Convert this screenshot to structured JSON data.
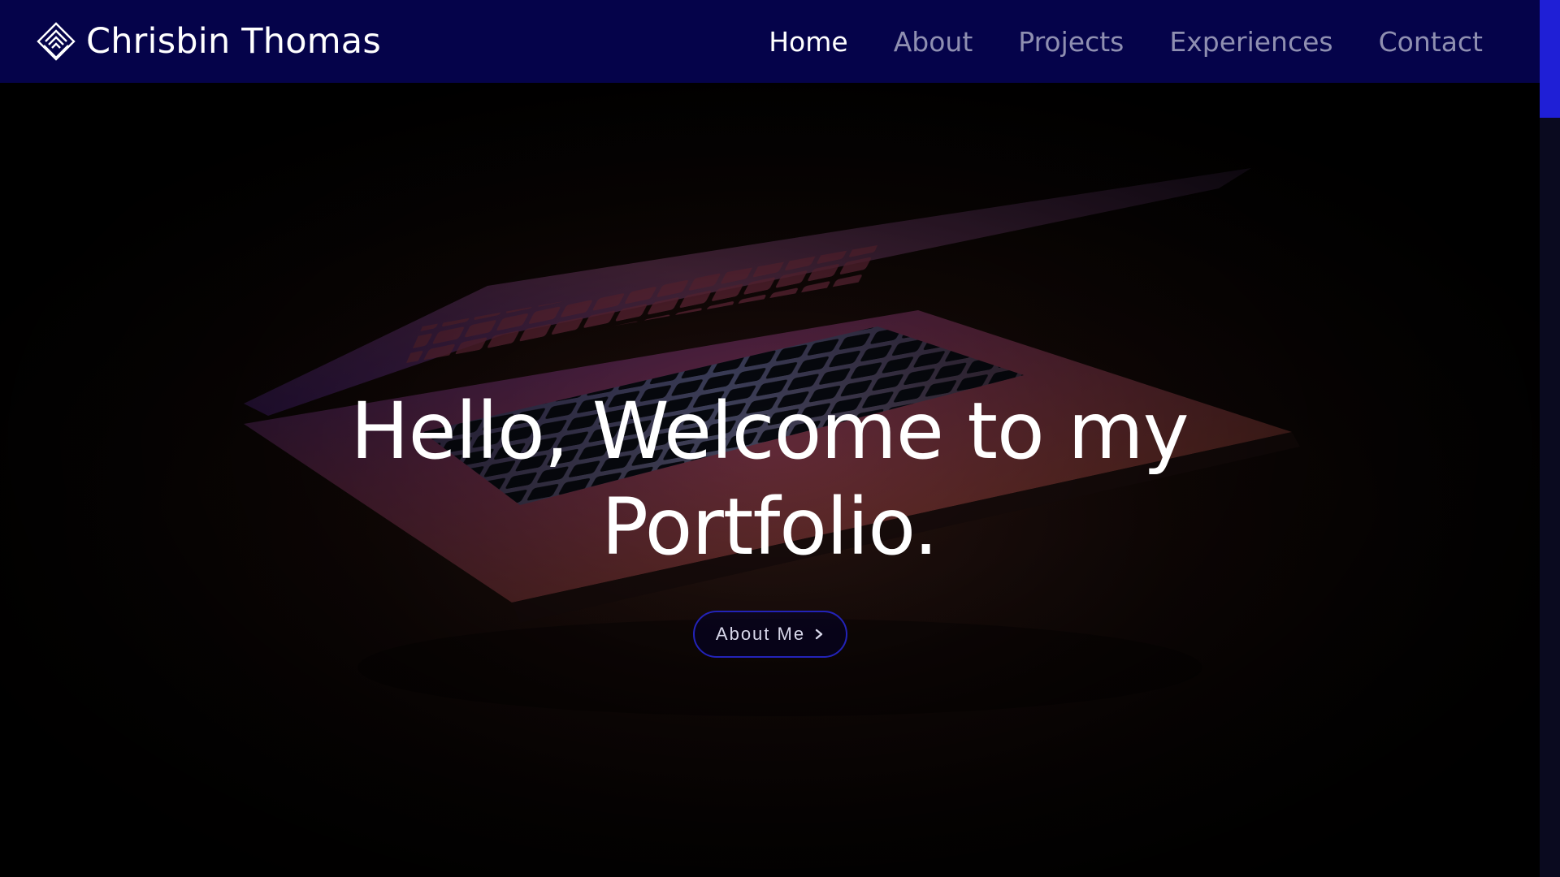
{
  "brand": {
    "name": "Chrisbin Thomas",
    "logo_icon": "diamond-stack-icon"
  },
  "nav": {
    "items": [
      {
        "label": "Home",
        "active": true
      },
      {
        "label": "About",
        "active": false
      },
      {
        "label": "Projects",
        "active": false
      },
      {
        "label": "Experiences",
        "active": false
      },
      {
        "label": "Contact",
        "active": false
      }
    ]
  },
  "hero": {
    "title": "Hello, Welcome to my Portfolio.",
    "button_label": "About Me",
    "button_icon": "chevron-right-icon",
    "background": "laptop-photo"
  },
  "colors": {
    "navbar_bg": "#05034a",
    "nav_active": "#ffffff",
    "nav_inactive": "#8f8fb1",
    "accent": "#1f1fd6"
  }
}
